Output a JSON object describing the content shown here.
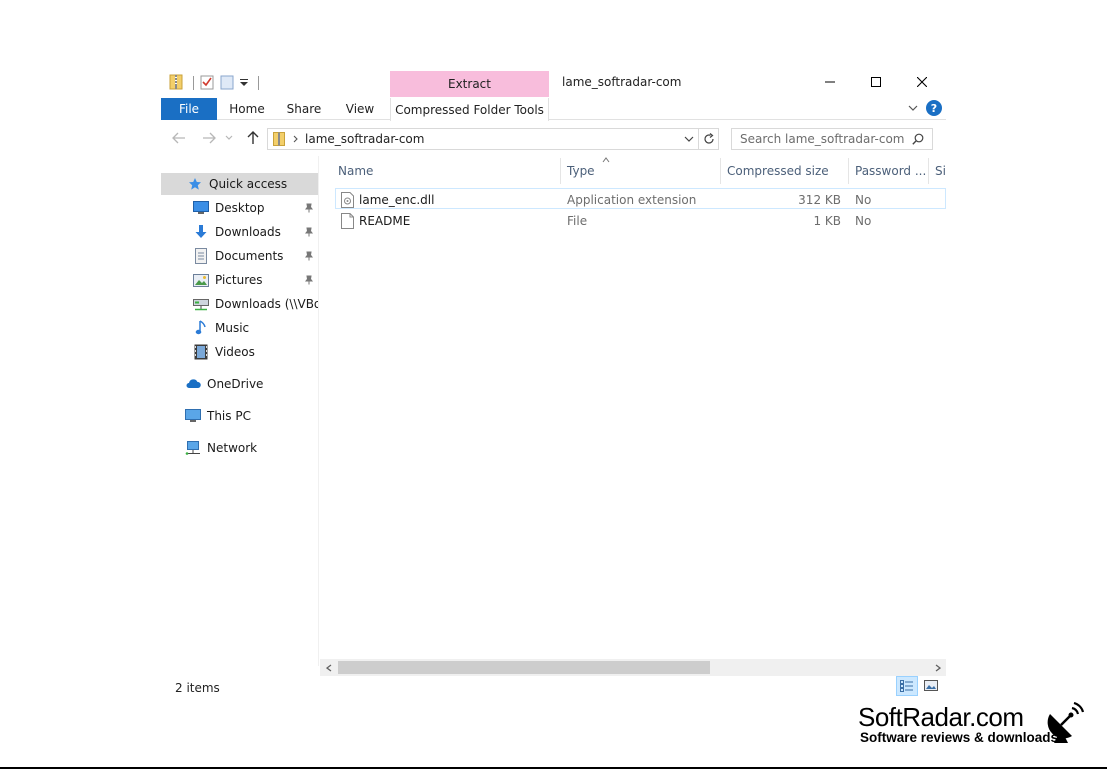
{
  "window": {
    "title": "lame_softradar-com",
    "extract_tab": "Extract",
    "ribbon_tabs": [
      "File",
      "Home",
      "Share",
      "View"
    ],
    "compressed_tools_tab": "Compressed Folder Tools",
    "help": "?"
  },
  "address": {
    "path": "lame_softradar-com",
    "search_placeholder": "Search lame_softradar-com"
  },
  "nav": {
    "quick_access": "Quick access",
    "items": [
      {
        "label": "Desktop",
        "icon": "desktop-icon",
        "pinned": true
      },
      {
        "label": "Downloads",
        "icon": "downloads-icon",
        "pinned": true
      },
      {
        "label": "Documents",
        "icon": "documents-icon",
        "pinned": true
      },
      {
        "label": "Pictures",
        "icon": "pictures-icon",
        "pinned": true
      },
      {
        "label": "Downloads (\\\\VBox",
        "icon": "network-drive-icon",
        "pinned": false
      },
      {
        "label": "Music",
        "icon": "music-icon",
        "pinned": false
      },
      {
        "label": "Videos",
        "icon": "videos-icon",
        "pinned": false
      }
    ],
    "onedrive": "OneDrive",
    "this_pc": "This PC",
    "network": "Network"
  },
  "columns": {
    "name": "Name",
    "type": "Type",
    "compressed_size": "Compressed size",
    "password": "Password ...",
    "size_partial": "Si"
  },
  "files": [
    {
      "name": "lame_enc.dll",
      "type": "Application extension",
      "size": "312 KB",
      "password": "No"
    },
    {
      "name": "README",
      "type": "File",
      "size": "1 KB",
      "password": "No"
    }
  ],
  "status": {
    "item_count": "2 items"
  },
  "watermark": {
    "title": "SoftRadar.com",
    "subtitle": "Software reviews & downloads"
  }
}
